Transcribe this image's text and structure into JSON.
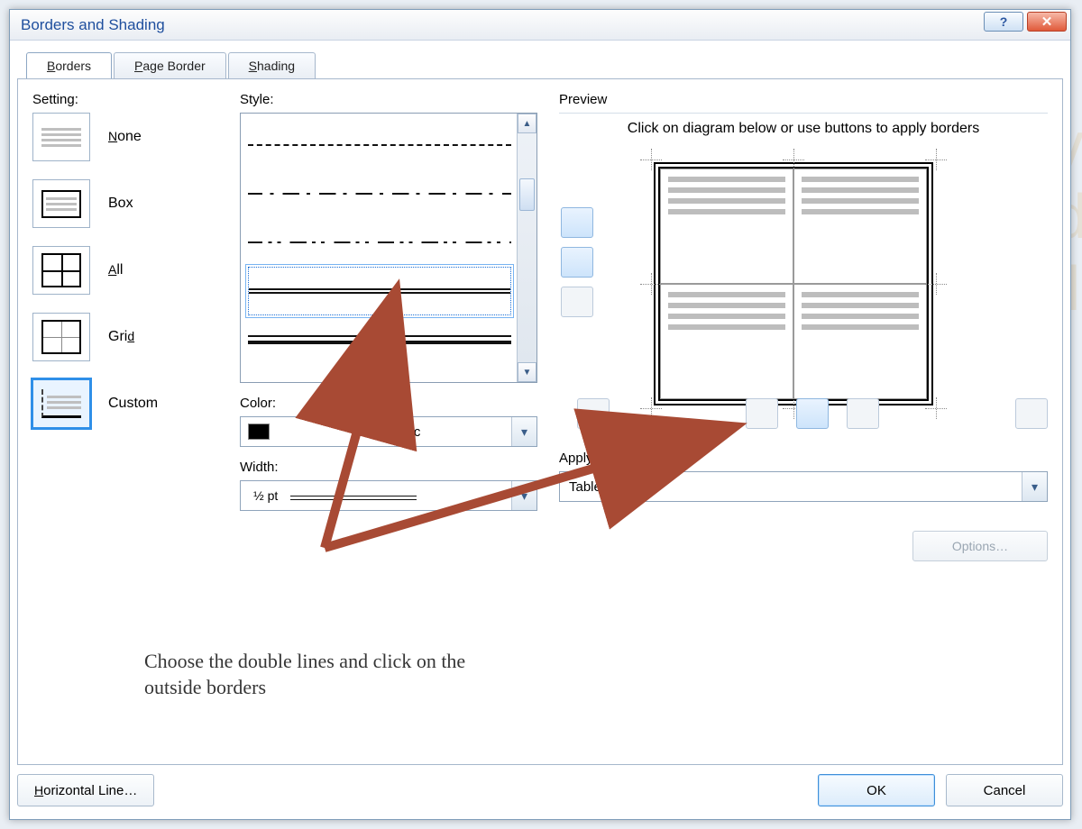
{
  "window": {
    "title": "Borders and Shading"
  },
  "tabs": {
    "borders": {
      "label": "Borders",
      "accel": "B"
    },
    "pageBorder": {
      "label": "Page Border",
      "accel": "P"
    },
    "shading": {
      "label": "Shading",
      "accel": "S"
    },
    "active": "borders"
  },
  "labels": {
    "setting": "Setting:",
    "style": "Style:",
    "color": "Color:",
    "width": "Width:",
    "preview": "Preview",
    "previewHint": "Click on diagram below or use buttons to apply borders",
    "applyTo": "Apply to:"
  },
  "settings": {
    "none": {
      "label": "None",
      "accel": "N"
    },
    "box": {
      "label": "Box",
      "accel": ""
    },
    "all": {
      "label": "All",
      "accel": "A"
    },
    "grid": {
      "label": "Grid",
      "accel": "d"
    },
    "custom": {
      "label": "Custom",
      "accel": ""
    },
    "selected": "custom"
  },
  "style": {
    "visibleItems": [
      "dashed",
      "dash-dot",
      "dash-dot-dot",
      "double",
      "triple"
    ],
    "selected": "double"
  },
  "color": {
    "value": "Automatic"
  },
  "width": {
    "value": "½ pt"
  },
  "applyTo": {
    "value": "Table"
  },
  "buttons": {
    "options": "Options…",
    "hline": "Horizontal Line…",
    "ok": "OK",
    "cancel": "Cancel"
  },
  "annotation": "Choose the double lines and click on the outside borders"
}
